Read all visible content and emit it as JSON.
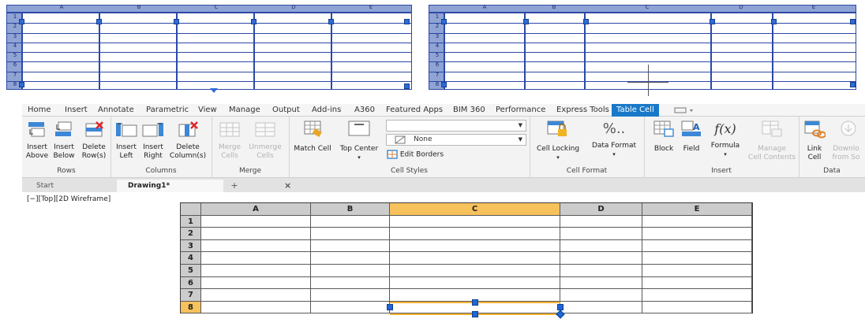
{
  "top_tables": {
    "left": {
      "columns": [
        "A",
        "B",
        "C",
        "D",
        "E"
      ],
      "rows": [
        "1",
        "2",
        "3",
        "4",
        "5",
        "6",
        "7",
        "8"
      ]
    },
    "right": {
      "columns": [
        "A",
        "B",
        "C",
        "D",
        "E"
      ],
      "rows": [
        "1",
        "2",
        "3",
        "4",
        "5",
        "6",
        "7",
        "8"
      ]
    }
  },
  "ribbon_tabs": [
    "Home",
    "Insert",
    "Annotate",
    "Parametric",
    "View",
    "Manage",
    "Output",
    "Add-ins",
    "A360",
    "Featured Apps",
    "BIM 360",
    "Performance",
    "Express Tools",
    "Table Cell"
  ],
  "active_tab": "Table Cell",
  "ribbon": {
    "rows": {
      "title": "Rows",
      "insert_above": [
        "Insert",
        "Above"
      ],
      "insert_below": [
        "Insert",
        "Below"
      ],
      "delete_rows": [
        "Delete",
        "Row(s)"
      ]
    },
    "columns": {
      "title": "Columns",
      "insert_left": [
        "Insert",
        "Left"
      ],
      "insert_right": [
        "Insert",
        "Right"
      ],
      "delete_columns": [
        "Delete",
        "Column(s)"
      ]
    },
    "merge": {
      "title": "Merge",
      "merge_cells": [
        "Merge",
        "Cells"
      ],
      "unmerge_cells": [
        "Unmerge",
        "Cells"
      ]
    },
    "cell_styles": {
      "title": "Cell Styles",
      "match_cell": "Match Cell",
      "top_center": "Top Center",
      "style_value": "",
      "background_value": "None",
      "edit_borders": "Edit Borders"
    },
    "cell_format": {
      "title": "Cell Format",
      "cell_locking": "Cell Locking",
      "data_format": "Data Format",
      "percent_glyph": "%.."
    },
    "insert": {
      "title": "Insert",
      "block": "Block",
      "field": "Field",
      "formula": "Formula",
      "formula_glyph": "f(x)",
      "manage_cell_contents": [
        "Manage",
        "Cell Contents"
      ]
    },
    "data": {
      "title": "Data",
      "link_cell": [
        "Link",
        "Cell"
      ],
      "download_from_source": [
        "Downlo",
        "from So"
      ]
    }
  },
  "file_tabs": {
    "start": "Start",
    "drawing": "Drawing1*",
    "close": "×",
    "new": "+"
  },
  "viewport_label": "[−][Top][2D Wireframe]",
  "main_table": {
    "columns": [
      "A",
      "B",
      "C",
      "D",
      "E"
    ],
    "rows": [
      "1",
      "2",
      "3",
      "4",
      "5",
      "6",
      "7",
      "8"
    ],
    "selected_column": "C",
    "selected_row": "8"
  },
  "colors": {
    "accent_tab": "#1979c9",
    "selection": "#f7c15c",
    "grip": "#1f67d6",
    "wireframe": "#2b49a6"
  }
}
